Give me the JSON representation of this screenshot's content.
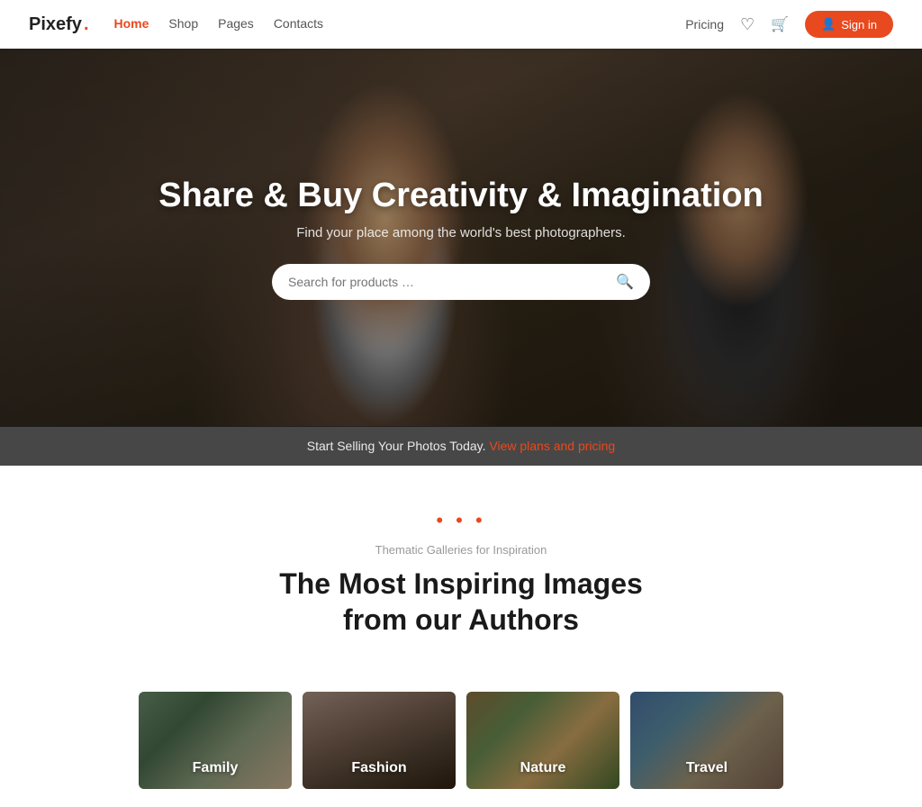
{
  "brand": {
    "name": "Pixefy",
    "dot": "."
  },
  "nav": {
    "links": [
      {
        "label": "Home",
        "active": true
      },
      {
        "label": "Shop",
        "active": false
      },
      {
        "label": "Pages",
        "active": false
      },
      {
        "label": "Contacts",
        "active": false
      }
    ],
    "pricing_label": "Pricing",
    "signin_label": "Sign in",
    "wishlist_icon": "♡",
    "cart_icon": "🛒"
  },
  "hero": {
    "title": "Share & Buy Creativity & Imagination",
    "subtitle": "Find your place among the world's best photographers.",
    "search_placeholder": "Search for products …",
    "bottom_text": "Start Selling Your Photos Today.",
    "bottom_link": "View plans and pricing"
  },
  "inspiration": {
    "dots": "• • •",
    "label": "Thematic Galleries for Inspiration",
    "title_line1": "The Most Inspiring Images",
    "title_line2": "from our Authors"
  },
  "gallery": {
    "cards": [
      {
        "id": "family",
        "label": "Family"
      },
      {
        "id": "fashion",
        "label": "Fashion"
      },
      {
        "id": "nature",
        "label": "Nature"
      },
      {
        "id": "travel",
        "label": "Travel"
      }
    ]
  }
}
